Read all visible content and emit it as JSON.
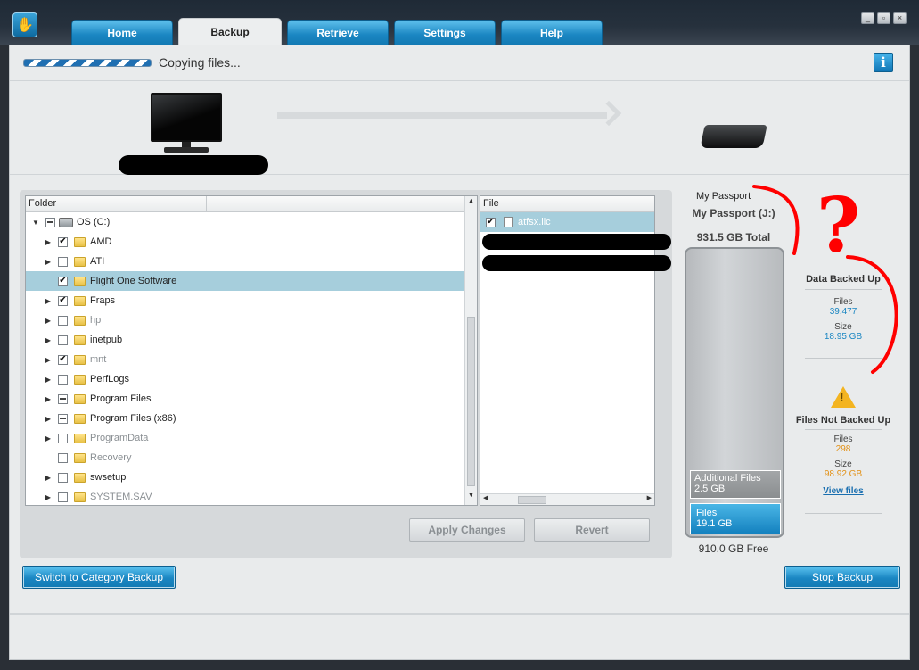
{
  "tabs": [
    {
      "label": "Home",
      "active": false
    },
    {
      "label": "Backup",
      "active": true
    },
    {
      "label": "Retrieve",
      "active": false
    },
    {
      "label": "Settings",
      "active": false
    },
    {
      "label": "Help",
      "active": false
    }
  ],
  "window_controls": {
    "minimize": "_",
    "restore": "▫",
    "close": "×"
  },
  "status": {
    "text": "Copying files...",
    "progress_indeterminate": true
  },
  "info_label": "i",
  "device": {
    "target_label": "My Passport"
  },
  "tree": {
    "column_header": "Folder",
    "root": {
      "label": "OS (C:)",
      "check": "partial",
      "expanded": true
    },
    "items": [
      {
        "label": "AMD",
        "check": "checked",
        "expandable": true,
        "dim": false,
        "selected": false
      },
      {
        "label": "ATI",
        "check": "unchecked",
        "expandable": true,
        "dim": false,
        "selected": false
      },
      {
        "label": "Flight One Software",
        "check": "checked",
        "expandable": false,
        "dim": false,
        "selected": true
      },
      {
        "label": "Fraps",
        "check": "checked",
        "expandable": true,
        "dim": false,
        "selected": false
      },
      {
        "label": "hp",
        "check": "unchecked",
        "expandable": true,
        "dim": true,
        "selected": false
      },
      {
        "label": "inetpub",
        "check": "unchecked",
        "expandable": true,
        "dim": false,
        "selected": false
      },
      {
        "label": "mnt",
        "check": "checked",
        "expandable": true,
        "dim": true,
        "selected": false
      },
      {
        "label": "PerfLogs",
        "check": "unchecked",
        "expandable": true,
        "dim": false,
        "selected": false
      },
      {
        "label": "Program Files",
        "check": "partial",
        "expandable": true,
        "dim": false,
        "selected": false
      },
      {
        "label": "Program Files (x86)",
        "check": "partial",
        "expandable": true,
        "dim": false,
        "selected": false
      },
      {
        "label": "ProgramData",
        "check": "unchecked",
        "expandable": true,
        "dim": true,
        "selected": false
      },
      {
        "label": "Recovery",
        "check": "unchecked",
        "expandable": false,
        "dim": true,
        "selected": false
      },
      {
        "label": "swsetup",
        "check": "unchecked",
        "expandable": true,
        "dim": false,
        "selected": false
      },
      {
        "label": "SYSTEM.SAV",
        "check": "unchecked",
        "expandable": true,
        "dim": true,
        "selected": false
      }
    ]
  },
  "files": {
    "column_header": "File",
    "items": [
      {
        "label": "atfsx.lic",
        "check": "checked"
      }
    ]
  },
  "buttons": {
    "apply": "Apply Changes",
    "revert": "Revert",
    "switch_category": "Switch to Category Backup",
    "stop_backup": "Stop Backup"
  },
  "drive": {
    "name": "My Passport (J:)",
    "total": "931.5 GB Total",
    "free": "910.0 GB Free",
    "segments": {
      "additional": {
        "label": "Additional Files",
        "value": "2.5 GB"
      },
      "files": {
        "label": "Files",
        "value": "19.1 GB"
      }
    }
  },
  "backed_up": {
    "title": "Data Backed Up",
    "files_label": "Files",
    "files_value": "39,477",
    "size_label": "Size",
    "size_value": "18.95 GB"
  },
  "not_backed_up": {
    "title": "Files Not Backed Up",
    "files_label": "Files",
    "files_value": "298",
    "size_label": "Size",
    "size_value": "98.92 GB",
    "link": "View files"
  },
  "annotation": {
    "mark": "?"
  },
  "colors": {
    "accent": "#1a86c2",
    "warning": "#e29015",
    "annotation": "#ff0000"
  }
}
